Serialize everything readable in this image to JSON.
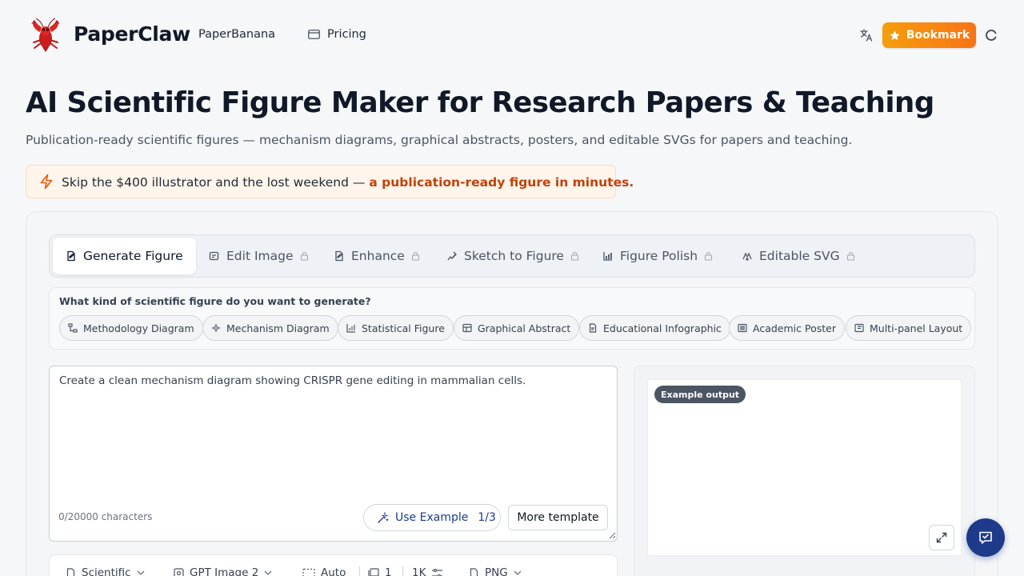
{
  "header": {
    "brand": "PaperClaw",
    "nav": {
      "paperbanana": "PaperBanana",
      "pricing": "Pricing"
    },
    "bookmark_label": "Bookmark"
  },
  "hero": {
    "title": "AI Scientific Figure Maker for Research Papers & Teaching",
    "subtitle": "Publication-ready scientific figures — mechanism diagrams, graphical abstracts, posters, and editable SVGs for papers and teaching."
  },
  "promo": {
    "text": "Skip the $400 illustrator and the lost weekend — ",
    "highlight": "a publication-ready figure in minutes."
  },
  "tabs": [
    {
      "label": "Generate Figure",
      "icon": "document-edit-icon",
      "locked": false,
      "active": true
    },
    {
      "label": "Edit Image",
      "icon": "edit-image-icon",
      "locked": true
    },
    {
      "label": "Enhance",
      "icon": "enhance-icon",
      "locked": true
    },
    {
      "label": "Sketch to Figure",
      "icon": "sketch-icon",
      "locked": true
    },
    {
      "label": "Figure Polish",
      "icon": "chart-icon",
      "locked": true
    },
    {
      "label": "Editable SVG",
      "icon": "svg-icon",
      "locked": true
    }
  ],
  "figure_type": {
    "question": "What kind of scientific figure do you want to generate?",
    "options": [
      "Methodology Diagram",
      "Mechanism Diagram",
      "Statistical Figure",
      "Graphical Abstract",
      "Educational Infographic",
      "Academic Poster",
      "Multi-panel Layout"
    ]
  },
  "prompt": {
    "value": "Create a clean mechanism diagram showing CRISPR gene editing in mammalian cells.",
    "char_count": "0/20000 characters",
    "use_example_label": "Use Example",
    "use_example_count": "1/3",
    "more_template_label": "More template"
  },
  "output": {
    "badge": "Example output"
  },
  "options": {
    "style": "Scientific",
    "model": "GPT Image 2",
    "aspect": "Auto",
    "count": "1",
    "resolution": "1K",
    "format": "PNG"
  },
  "colors": {
    "accent": "#1e3a8a",
    "bookmark_start": "#f59e0b",
    "bookmark_end": "#f97316",
    "promo_highlight": "#c2410c"
  }
}
